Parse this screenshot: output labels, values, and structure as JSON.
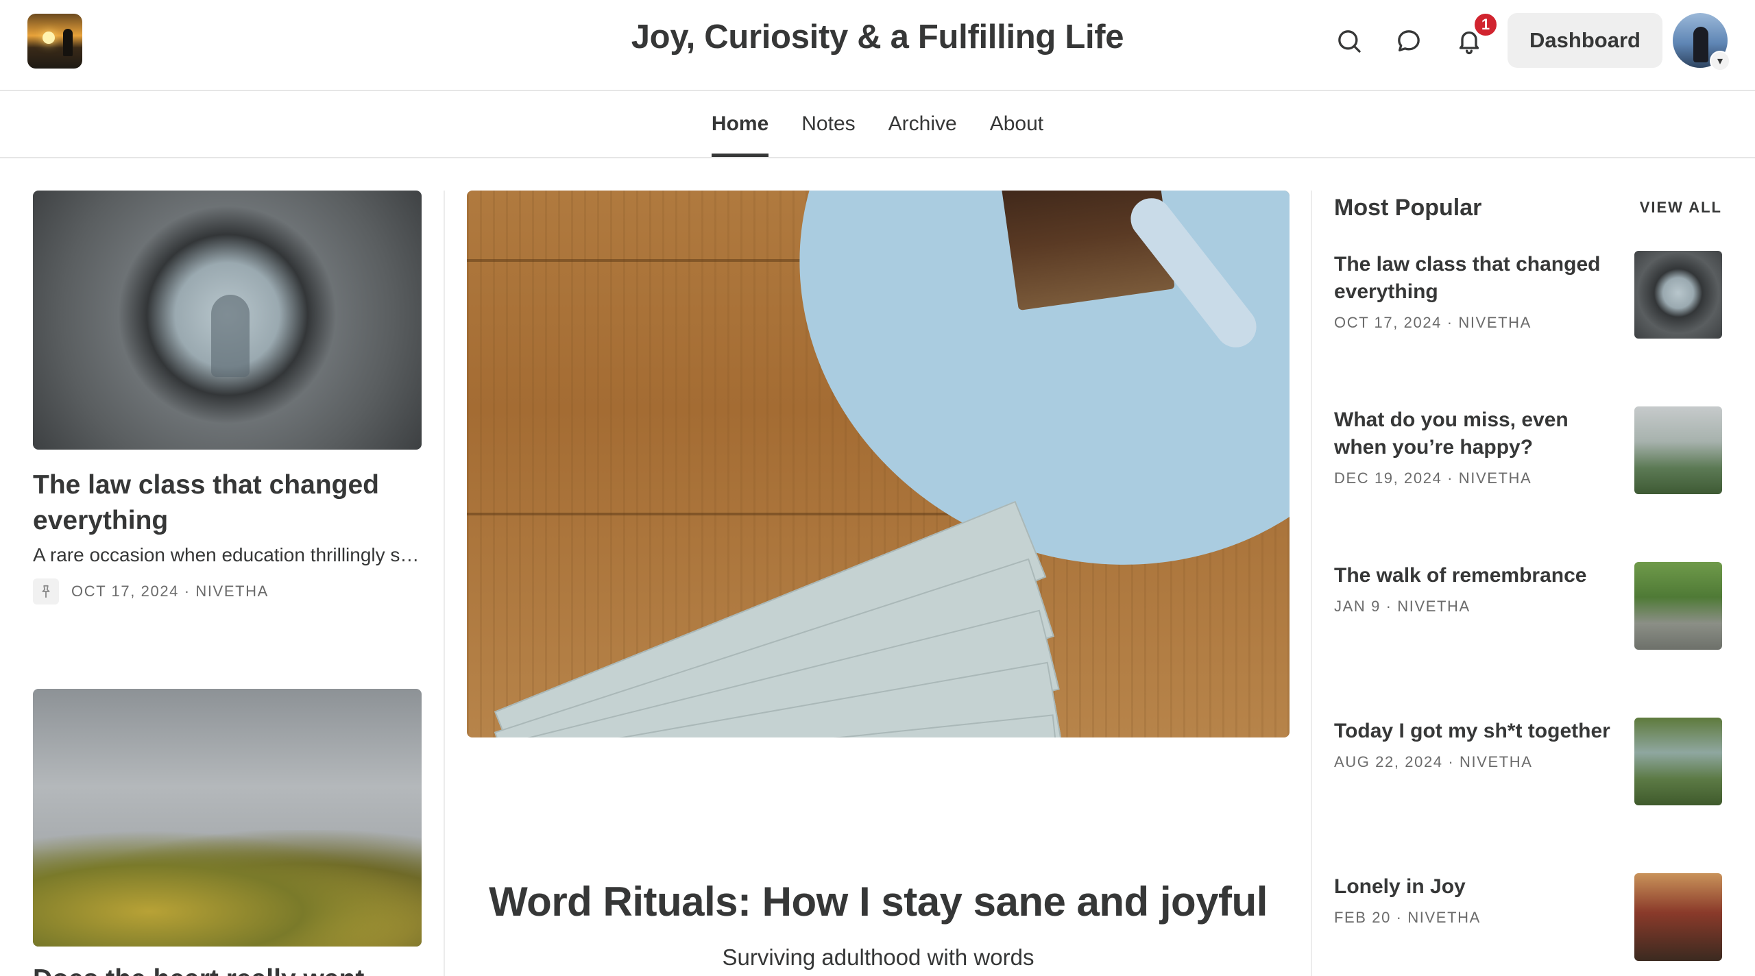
{
  "header": {
    "site_title": "Joy, Curiosity & a Fulfilling Life",
    "notification_count": "1",
    "dashboard_label": "Dashboard",
    "avatar_caret": "▾",
    "icons": [
      "search-icon",
      "chat-icon",
      "bell-icon",
      "chevron-down-icon"
    ]
  },
  "nav": {
    "tabs": [
      {
        "label": "Home",
        "active": true
      },
      {
        "label": "Notes",
        "active": false
      },
      {
        "label": "Archive",
        "active": false
      },
      {
        "label": "About",
        "active": false
      }
    ]
  },
  "left_posts": [
    {
      "title": "The law class that changed everything",
      "subtitle": "A rare occasion when education thrillingly surprised me",
      "meta": "OCT 17, 2024 · NIVETHA",
      "pinned": true
    },
    {
      "title": "Does the heart really want"
    }
  ],
  "featured": {
    "title": "Word Rituals: How I stay sane and joyful",
    "subtitle": "Surviving adulthood with words"
  },
  "most_popular": {
    "heading": "Most Popular",
    "view_all": "VIEW ALL",
    "items": [
      {
        "title": "The law class that changed everything",
        "meta": "OCT 17, 2024 · NIVETHA"
      },
      {
        "title": "What do you miss, even when you’re happy?",
        "meta": "DEC 19, 2024 · NIVETHA"
      },
      {
        "title": "The walk of remembrance",
        "meta": "JAN 9 · NIVETHA"
      },
      {
        "title": "Today I got my sh*t together",
        "meta": "AUG 22, 2024 · NIVETHA"
      },
      {
        "title": "Lonely in Joy",
        "meta": "FEB 20 · NIVETHA"
      }
    ]
  },
  "colors": {
    "text": "#363737",
    "meta": "#6b6b6b",
    "badge": "#d1242f",
    "button_bg": "#efefef",
    "divider": "#e6e6e6"
  }
}
